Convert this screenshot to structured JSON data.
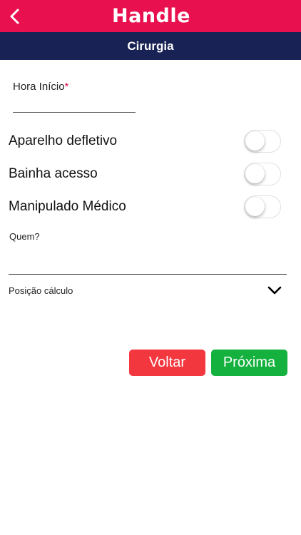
{
  "header": {
    "logo_text": "Handle",
    "back_icon": "chevron-left-icon",
    "brand_color": "#e8104e"
  },
  "subheader": {
    "title": "Cirurgia",
    "color": "#182254"
  },
  "form": {
    "hora_inicio": {
      "label": "Hora Início",
      "required_mark": "*",
      "value": ""
    },
    "toggles": [
      {
        "label": "Aparelho defletivo",
        "checked": false
      },
      {
        "label": "Bainha acesso",
        "checked": false
      },
      {
        "label": "Manipulado Médico",
        "checked": false
      }
    ],
    "quem": {
      "label": "Quem?",
      "value": ""
    },
    "posicao_calculo": {
      "label": "Posição cálculo",
      "icon": "chevron-down-icon",
      "selected": ""
    }
  },
  "actions": {
    "back_label": "Voltar",
    "next_label": "Próxima",
    "back_color": "#f2373f",
    "next_color": "#14b13e"
  }
}
